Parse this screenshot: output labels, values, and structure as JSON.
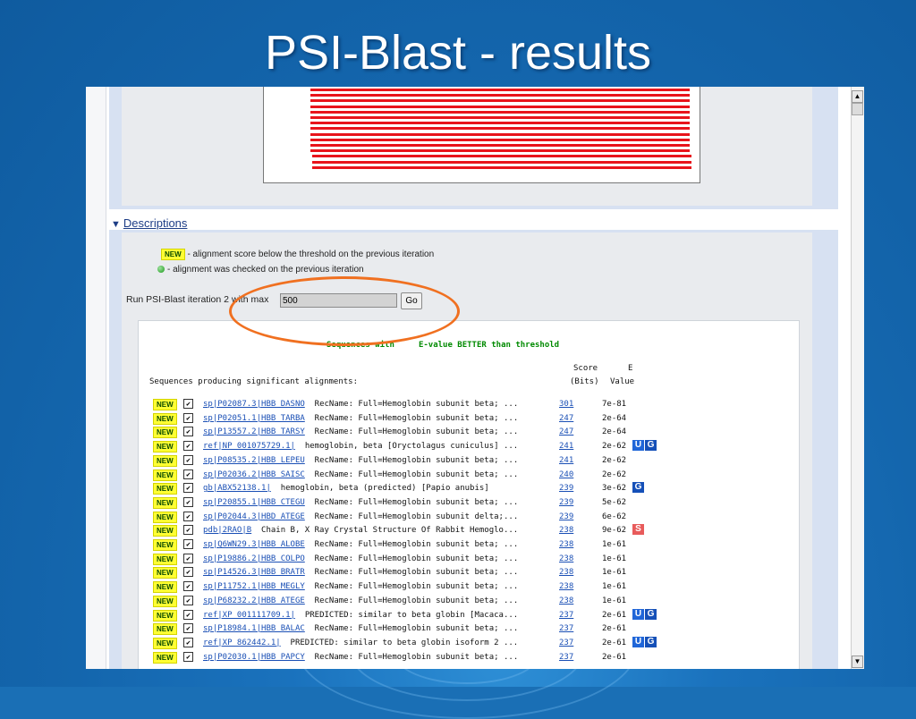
{
  "slide": {
    "title": "PSI-Blast - results"
  },
  "descriptions": {
    "toggle_icon": "triangle-down-icon",
    "label": "Descriptions",
    "legend_new_tag": "NEW",
    "legend_new_text": "- alignment score below the threshold on the previous iteration",
    "legend_checked_text": "- alignment was checked on the previous iteration"
  },
  "run": {
    "label": "Run PSI-Blast iteration 2 with max",
    "max_value": "500",
    "go_label": "Go"
  },
  "results": {
    "title": "Sequences with     E-value BETTER than threshold",
    "header_score": "Score",
    "header_e": "E",
    "header_left": "Sequences producing significant alignments:",
    "header_bits": "(Bits)",
    "header_value": "Value",
    "new_tag": "NEW",
    "rows": [
      {
        "acc": "sp|P02087.3|HBB_DASNO",
        "desc": "RecName: Full=Hemoglobin subunit beta; ...",
        "score": "301",
        "evalue": "7e-81",
        "links": []
      },
      {
        "acc": "sp|P02051.1|HBB_TARBA",
        "desc": "RecName: Full=Hemoglobin subunit beta; ...",
        "score": "247",
        "evalue": "2e-64",
        "links": []
      },
      {
        "acc": "sp|P13557.2|HBB_TARSY",
        "desc": "RecName: Full=Hemoglobin subunit beta; ...",
        "score": "247",
        "evalue": "2e-64",
        "links": []
      },
      {
        "acc": "ref|NP_001075729.1|",
        "desc": "hemoglobin, beta [Oryctolagus cuniculus] ...",
        "score": "241",
        "evalue": "2e-62",
        "links": [
          "U",
          "G"
        ]
      },
      {
        "acc": "sp|P08535.2|HBB_LEPEU",
        "desc": "RecName: Full=Hemoglobin subunit beta; ...",
        "score": "241",
        "evalue": "2e-62",
        "links": []
      },
      {
        "acc": "sp|P02036.2|HBB_SAISC",
        "desc": "RecName: Full=Hemoglobin subunit beta; ...",
        "score": "240",
        "evalue": "2e-62",
        "links": []
      },
      {
        "acc": "gb|ABX52138.1|",
        "desc": "hemoglobin, beta (predicted) [Papio anubis]",
        "score": "239",
        "evalue": "3e-62",
        "links": [
          "G"
        ]
      },
      {
        "acc": "sp|P20855.1|HBB_CTEGU",
        "desc": "RecName: Full=Hemoglobin subunit beta; ...",
        "score": "239",
        "evalue": "5e-62",
        "links": []
      },
      {
        "acc": "sp|P02044.3|HBD_ATEGE",
        "desc": "RecName: Full=Hemoglobin subunit delta;...",
        "score": "239",
        "evalue": "6e-62",
        "links": []
      },
      {
        "acc": "pdb|2RAO|B",
        "desc": "Chain B, X Ray Crystal Structure Of Rabbit Hemoglo...",
        "score": "238",
        "evalue": "9e-62",
        "links": [
          "S"
        ]
      },
      {
        "acc": "sp|Q6WN29.3|HBB_ALOBE",
        "desc": "RecName: Full=Hemoglobin subunit beta; ...",
        "score": "238",
        "evalue": "1e-61",
        "links": []
      },
      {
        "acc": "sp|P19886.2|HBB_COLPO",
        "desc": "RecName: Full=Hemoglobin subunit beta; ...",
        "score": "238",
        "evalue": "1e-61",
        "links": []
      },
      {
        "acc": "sp|P14526.3|HBB_BRATR",
        "desc": "RecName: Full=Hemoglobin subunit beta; ...",
        "score": "238",
        "evalue": "1e-61",
        "links": []
      },
      {
        "acc": "sp|P11752.1|HBB_MEGLY",
        "desc": "RecName: Full=Hemoglobin subunit beta; ...",
        "score": "238",
        "evalue": "1e-61",
        "links": []
      },
      {
        "acc": "sp|P68232.2|HBB_ATEGE",
        "desc": "RecName: Full=Hemoglobin subunit beta; ...",
        "score": "238",
        "evalue": "1e-61",
        "links": []
      },
      {
        "acc": "ref|XP_001111709.1|",
        "desc": "PREDICTED: similar to beta globin [Macaca...",
        "score": "237",
        "evalue": "2e-61",
        "links": [
          "U",
          "G"
        ]
      },
      {
        "acc": "sp|P18984.1|HBB_BALAC",
        "desc": "RecName: Full=Hemoglobin subunit beta; ...",
        "score": "237",
        "evalue": "2e-61",
        "links": []
      },
      {
        "acc": "ref|XP_862442.1|",
        "desc": "PREDICTED: similar to beta globin isoform 2 ...",
        "score": "237",
        "evalue": "2e-61",
        "links": [
          "U",
          "G"
        ]
      },
      {
        "acc": "sp|P02030.1|HBB_PAPCY",
        "desc": "RecName: Full=Hemoglobin subunit beta; ...",
        "score": "237",
        "evalue": "2e-61",
        "links": []
      }
    ]
  },
  "colors": {
    "slide_blue": "#1a6fb5",
    "annotation_orange": "#f07020",
    "alignment_red": "#e8141b",
    "link_blue": "#1a4fb5",
    "result_title_green": "#008a00"
  }
}
